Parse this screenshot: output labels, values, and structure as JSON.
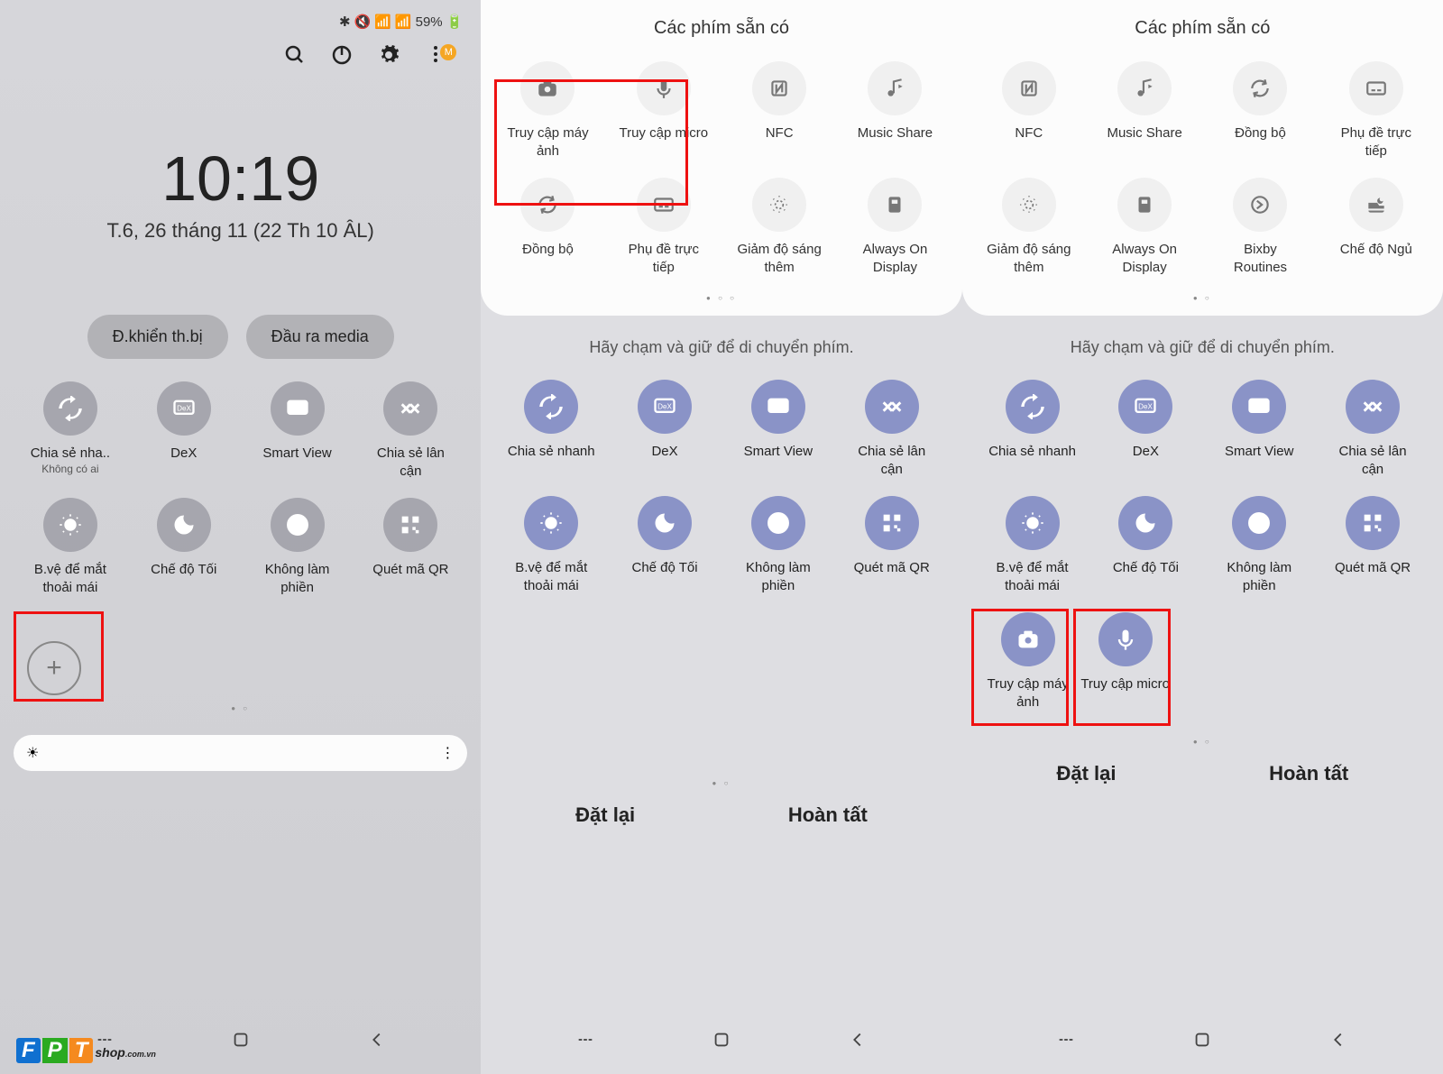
{
  "status": {
    "battery": "59%"
  },
  "clock": {
    "time": "10:19",
    "date": "T.6, 26 tháng 11 (22 Th 10 ÂL)"
  },
  "pills": {
    "device": "Đ.khiển th.bị",
    "media": "Đầu ra media"
  },
  "left_tiles": {
    "r1": [
      {
        "label": "Chia sẻ nha..",
        "sub": "Không có ai"
      },
      {
        "label": "DeX"
      },
      {
        "label": "Smart View"
      },
      {
        "label": "Chia sẻ lân cận"
      }
    ],
    "r2": [
      {
        "label": "B.vệ để mắt thoải mái"
      },
      {
        "label": "Chế độ Tối"
      },
      {
        "label": "Không làm phiền"
      },
      {
        "label": "Quét mã QR"
      }
    ]
  },
  "top_title": "Các phím sẵn có",
  "mid_top": {
    "r1": [
      {
        "label": "Truy cập máy ảnh"
      },
      {
        "label": "Truy cập micro"
      },
      {
        "label": "NFC"
      },
      {
        "label": "Music Share"
      }
    ],
    "r2": [
      {
        "label": "Đồng bộ"
      },
      {
        "label": "Phụ đề trực tiếp"
      },
      {
        "label": "Giảm độ sáng thêm"
      },
      {
        "label": "Always On Display"
      }
    ]
  },
  "right_top": {
    "r1": [
      {
        "label": "NFC"
      },
      {
        "label": "Music Share"
      },
      {
        "label": "Đồng bộ"
      },
      {
        "label": "Phụ đề trực tiếp"
      }
    ],
    "r2": [
      {
        "label": "Giảm độ sáng thêm"
      },
      {
        "label": "Always On Display"
      },
      {
        "label": "Bixby Routines"
      },
      {
        "label": "Chế độ Ngủ"
      }
    ]
  },
  "instruction": "Hãy chạm và giữ để di chuyển phím.",
  "lower": {
    "r1": [
      {
        "label": "Chia sẻ nhanh"
      },
      {
        "label": "DeX"
      },
      {
        "label": "Smart View"
      },
      {
        "label": "Chia sẻ lân cận"
      }
    ],
    "r2": [
      {
        "label": "B.vệ để mắt thoải mái"
      },
      {
        "label": "Chế độ Tối"
      },
      {
        "label": "Không làm phiền"
      },
      {
        "label": "Quét mã QR"
      }
    ]
  },
  "right_added": {
    "r3": [
      {
        "label": "Truy cập máy ảnh"
      },
      {
        "label": "Truy cập micro"
      }
    ]
  },
  "buttons": {
    "reset": "Đặt lại",
    "done": "Hoàn tất"
  },
  "watermark": {
    "text": "shop",
    "suffix": ".com.vn"
  },
  "badge": "M"
}
